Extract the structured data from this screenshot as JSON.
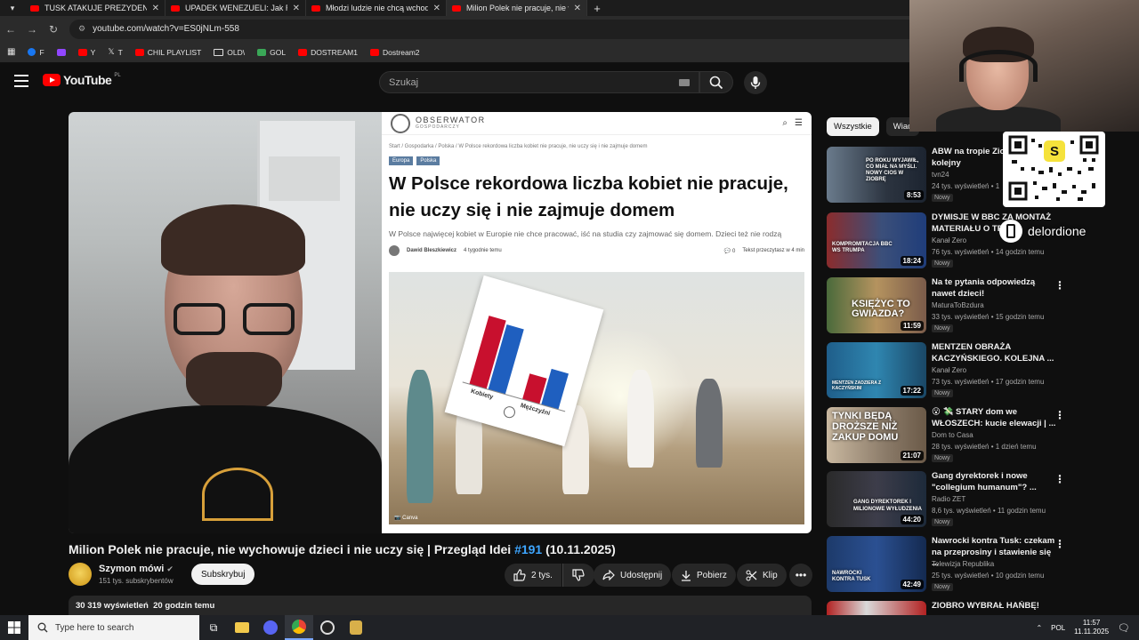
{
  "browser": {
    "tabs": [
      {
        "title": "TUSK ATAKUJE PREZYDENTA. JE",
        "active": false
      },
      {
        "title": "UPADEK WENEZUELI: Jak ROPA",
        "active": false
      },
      {
        "title": "Młodzi ludzie nie chcą wchodzi",
        "active": false
      },
      {
        "title": "Milion Polek nie pracuje, nie wy",
        "active": true
      }
    ],
    "url": "youtube.com/watch?v=ES0jNLm-558",
    "bookmarks": [
      "F",
      "Y",
      "T",
      "CHIL PLAYLIST",
      "OLD\\",
      "GOL",
      "DOSTREAM1",
      "Dostream2"
    ]
  },
  "youtube": {
    "logo": "YouTube",
    "country": "PL",
    "search_placeholder": "Szukaj"
  },
  "article": {
    "site_name": "OBSERWATOR",
    "site_sub": "GOSPODARCZY",
    "breadcrumb": "Start / Gospodarka / Polska / W Polsce rekordowa liczba kobiet nie pracuje, nie uczy się i nie zajmuje domem",
    "tags": [
      "Europa",
      "Polska"
    ],
    "title": "W Polsce rekordowa liczba kobiet nie pracuje, nie uczy się i nie zajmuje domem",
    "lead": "W Polsce najwięcej kobiet w Europie nie chce pracować, iść na studia czy zajmować się domem. Dzieci też nie rodzą",
    "author": "Dawid Bleszkiewicz",
    "posted": "4 tygodnie temu",
    "comments": "0",
    "read_time": "Tekst przeczytasz w 4 min",
    "photo_credit": "Canva",
    "chart_card_labels": [
      "Kobiety",
      "Mężczyźni"
    ]
  },
  "video": {
    "title_main": "Milion Polek nie pracuje, nie wychowuje dzieci i nie uczy się | Przegląd Idei ",
    "title_hash": "#191",
    "title_date": " (10.11.2025)",
    "channel": "Szymon mówi",
    "subscribers": "151 tys. subskrybentów",
    "subscribe_label": "Subskrybuj",
    "likes": "2 tys.",
    "share_label": "Udostępnij",
    "download_label": "Pobierz",
    "clip_label": "Klip",
    "views": "30 319 wyświetleń",
    "uploaded": "20 godzin temu"
  },
  "sidebar": {
    "chips": [
      "Wszystkie",
      "Wiad"
    ],
    "items": [
      {
        "title": "ABW na tropie Zio zadaje mu kolejny",
        "channel": "tvn24",
        "meta": "24 tys. wyświetleń • 1",
        "badge": "Nowy",
        "duration": "8:53",
        "thumb_text": "PO ROKU WYJAWIŁ, CO MIAŁ NA MYŚLI. NOWY CIOS W ZIOBRĘ"
      },
      {
        "title": "DYMISJE W BBC ZA MONTAŻ MATERIAŁU O TR",
        "channel": "Kanał Zero",
        "meta": "76 tys. wyświetleń • 14 godzin temu",
        "badge": "Nowy",
        "duration": "18:24",
        "thumb_text": "KOMPROMITACJA BBC WS TRUMPA"
      },
      {
        "title": "Na te pytania odpowiedzą nawet dzieci!",
        "channel": "MaturaToBzdura",
        "meta": "33 tys. wyświetleń • 15 godzin temu",
        "badge": "Nowy",
        "duration": "11:59",
        "thumb_text": "KSIĘŻYC TO GWIAZDA?"
      },
      {
        "title": "MENTZEN OBRAŻA KACZYŃSKIEGO. KOLEJNA ...",
        "channel": "Kanał Zero",
        "meta": "73 tys. wyświetleń • 17 godzin temu",
        "badge": "Nowy",
        "duration": "17:22",
        "thumb_text": "MENTZEN ZADZIERA Z KACZYŃSKIM"
      },
      {
        "title": "😮 💸 STARY dom we WŁOSZECH: kucie elewacji | ...",
        "channel": "Dom to Casa",
        "meta": "28 tys. wyświetleń • 1 dzień temu",
        "badge": "Nowy",
        "duration": "21:07",
        "thumb_text": "TYNKI BĘDĄ DROŻSZE NIŻ ZAKUP DOMU"
      },
      {
        "title": "Gang dyrektorek i nowe \"collegium humanum\"? ...",
        "channel": "Radio ZET",
        "meta": "8,6 tys. wyświetleń • 11 godzin temu",
        "badge": "Nowy",
        "duration": "44:20",
        "thumb_text": "GANG DYREKTOREK I MILIONOWE WYŁUDZENIA"
      },
      {
        "title": "Nawrocki kontra Tusk: czekam na przeprosiny i stawienie się ...",
        "channel": "Telewizja Republika",
        "meta": "25 tys. wyświetleń • 10 godzin temu",
        "badge": "Nowy",
        "duration": "42:49",
        "thumb_text": "NAWROCKI KONTRA TUSK"
      },
      {
        "title": "ZIOBRO WYBRAŁ HAŃBĘ!",
        "channel": "",
        "meta": "",
        "badge": "",
        "duration": "",
        "thumb_text": ""
      }
    ]
  },
  "overlay": {
    "handle": "delordione",
    "qr_letter": "S"
  },
  "taskbar": {
    "search_placeholder": "Type here to search",
    "lang": "POL",
    "time": "11:57",
    "date": "11.11.2025"
  },
  "colors": {
    "yt_red": "#ff0000",
    "bg": "#0f0f0f",
    "link_blue": "#3ea6ff",
    "bar_red": "#c8102e",
    "bar_blue": "#1f5fbf"
  }
}
